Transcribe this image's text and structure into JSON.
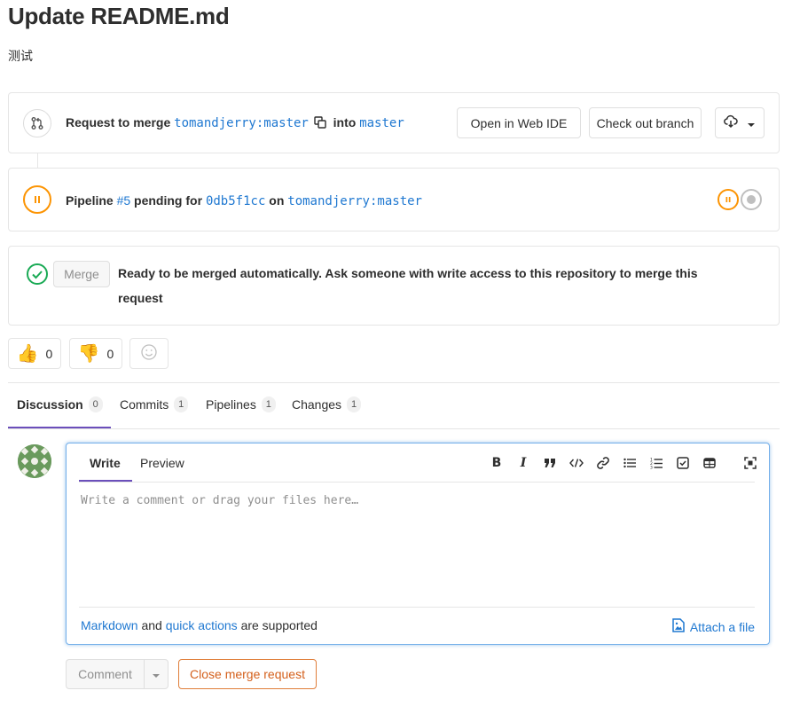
{
  "page": {
    "title": "Update README.md",
    "description": "测试"
  },
  "merge_request_widget": {
    "request_label": "Request to merge",
    "source_branch": "tomandjerry:master",
    "into_label": "into",
    "target_branch": "master",
    "open_web_ide_label": "Open in Web IDE",
    "check_out_branch_label": "Check out branch",
    "download_icon": "cloud-download-icon"
  },
  "pipeline_widget": {
    "pipeline_label": "Pipeline",
    "pipeline_id": "#5",
    "status_text": "pending for",
    "commit_sha": "0db5f1cc",
    "on_label": "on",
    "branch": "tomandjerry:master",
    "status_color": "#fc9403"
  },
  "merge_widget": {
    "merge_button_label": "Merge",
    "message": "Ready to be merged automatically. Ask someone with write access to this repository to merge this request",
    "success_color": "#1aaa55"
  },
  "awards": {
    "thumbs_up_count": "0",
    "thumbs_down_count": "0"
  },
  "tabs": [
    {
      "label": "Discussion",
      "count": "0"
    },
    {
      "label": "Commits",
      "count": "1"
    },
    {
      "label": "Pipelines",
      "count": "1"
    },
    {
      "label": "Changes",
      "count": "1"
    }
  ],
  "editor": {
    "write_tab": "Write",
    "preview_tab": "Preview",
    "placeholder": "Write a comment or drag your files here…",
    "footer_markdown": "Markdown",
    "footer_and": "and",
    "footer_quick_actions": "quick actions",
    "footer_supported": "are supported",
    "attach_label": "Attach a file",
    "toolbar": [
      "bold-icon",
      "italic-icon",
      "quote-icon",
      "code-icon",
      "link-icon",
      "bullet-list-icon",
      "numbered-list-icon",
      "task-list-icon",
      "table-icon",
      "fullscreen-icon"
    ]
  },
  "actions": {
    "comment_label": "Comment",
    "close_label": "Close merge request"
  },
  "colors": {
    "link": "#1f78d1",
    "active_tab": "#6b4fbb",
    "focus_border": "#73afea",
    "close_border": "#e07d39"
  }
}
